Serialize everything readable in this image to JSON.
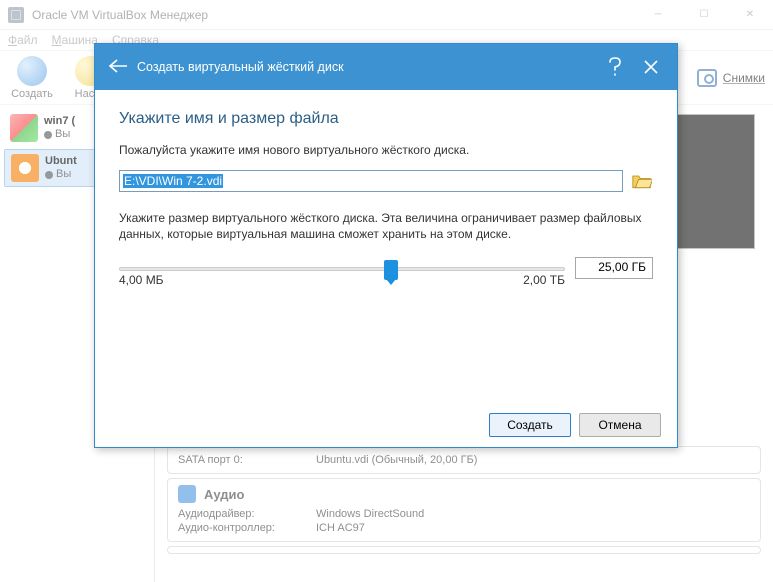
{
  "window": {
    "title": "Oracle VM VirtualBox Менеджер"
  },
  "menu": {
    "file": "Файл",
    "machine": "Машина",
    "help": "Справка"
  },
  "toolbar": {
    "create": "Создать",
    "settings": "Настр",
    "snapshots": "Снимки"
  },
  "sidebar": {
    "items": [
      {
        "name": "win7 (",
        "state": "Вы"
      },
      {
        "name": "Ubunt",
        "state": "Вы"
      }
    ]
  },
  "detail": {
    "sata_row_k": "SATA порт 0:",
    "sata_row_v": "Ubuntu.vdi (Обычный, 20,00 ГБ)",
    "audio_title": "Аудио",
    "audio_driver_k": "Аудиодрайвер:",
    "audio_driver_v": "Windows DirectSound",
    "audio_ctrl_k": "Аудио-контроллер:",
    "audio_ctrl_v": "ICH AC97"
  },
  "modal": {
    "header_title": "Создать виртуальный жёсткий диск",
    "heading": "Укажите имя и размер файла",
    "p1": "Пожалуйста укажите имя нового виртуального жёсткого диска.",
    "path_value": "E:\\VDI\\Win 7-2.vdi",
    "p2": "Укажите размер виртуального жёсткого диска. Эта величина ограничивает размер файловых данных, которые виртуальная машина сможет хранить на этом диске.",
    "size_display": "25,00 ГБ",
    "range_min": "4,00 МБ",
    "range_max": "2,00 ТБ",
    "slider_percent": 61,
    "btn_create": "Создать",
    "btn_cancel": "Отмена"
  }
}
